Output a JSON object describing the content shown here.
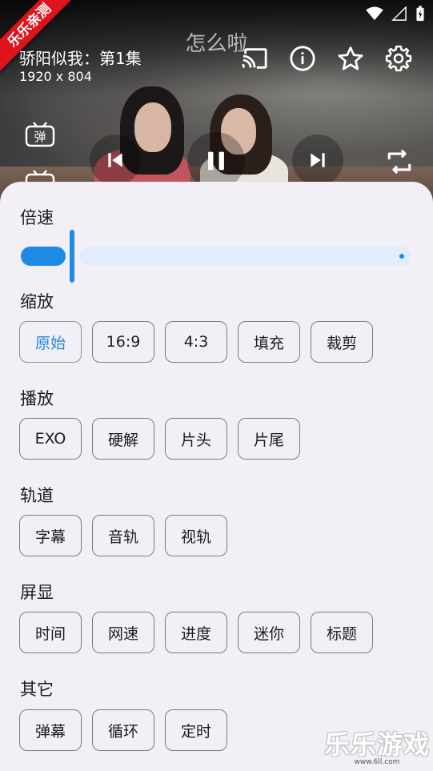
{
  "brand": {
    "ribbon": "乐乐亲测"
  },
  "player": {
    "center_title": "怎么啦",
    "episode_title": "骄阳似我：第1集",
    "resolution": "1920 x 804",
    "side_icon_label": "弹"
  },
  "icons": {
    "cast": "cast-icon",
    "info": "info-icon",
    "favorite": "star-icon",
    "settings": "gear-icon",
    "prev": "skip-previous-icon",
    "pause": "pause-icon",
    "next": "skip-next-icon",
    "rotate": "screen-rotate-icon"
  },
  "speed": {
    "label": "倍速"
  },
  "sections": [
    {
      "key": "scale",
      "label": "缩放",
      "options": [
        "原始",
        "16:9",
        "4:3",
        "填充",
        "裁剪"
      ],
      "selected": 0
    },
    {
      "key": "play",
      "label": "播放",
      "options": [
        "EXO",
        "硬解",
        "片头",
        "片尾"
      ],
      "selected": -1
    },
    {
      "key": "track",
      "label": "轨道",
      "options": [
        "字幕",
        "音轨",
        "视轨"
      ],
      "selected": -1
    },
    {
      "key": "display",
      "label": "屏显",
      "options": [
        "时间",
        "网速",
        "进度",
        "迷你",
        "标题"
      ],
      "selected": -1
    },
    {
      "key": "other",
      "label": "其它",
      "options": [
        "弹幕",
        "循环",
        "定时"
      ],
      "selected": -1
    }
  ],
  "watermark": {
    "main": "乐乐游戏",
    "sub": "www.6ll.com"
  },
  "colors": {
    "accent": "#1e8ae6",
    "sheet_bg": "#f2eff7",
    "ribbon": "#e0121b"
  }
}
